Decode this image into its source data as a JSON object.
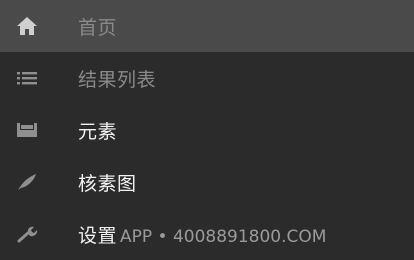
{
  "colors": {
    "background": "#2b2b2b",
    "active_row": "#4a4a4a",
    "muted_text": "#8a8a8a",
    "bright_text": "#f2f2f2",
    "icon": "#8f8f8f"
  },
  "menu": {
    "items": [
      {
        "label": "首页",
        "icon": "home-icon",
        "active": true
      },
      {
        "label": "结果列表",
        "icon": "list-icon",
        "active": false
      },
      {
        "label": "元素",
        "icon": "tray-icon",
        "active": false
      },
      {
        "label": "核素图",
        "icon": "feather-icon",
        "active": false
      },
      {
        "label": "设置",
        "icon": "wrench-icon",
        "active": false
      }
    ]
  },
  "watermark": "APP • 4008891800.COM"
}
